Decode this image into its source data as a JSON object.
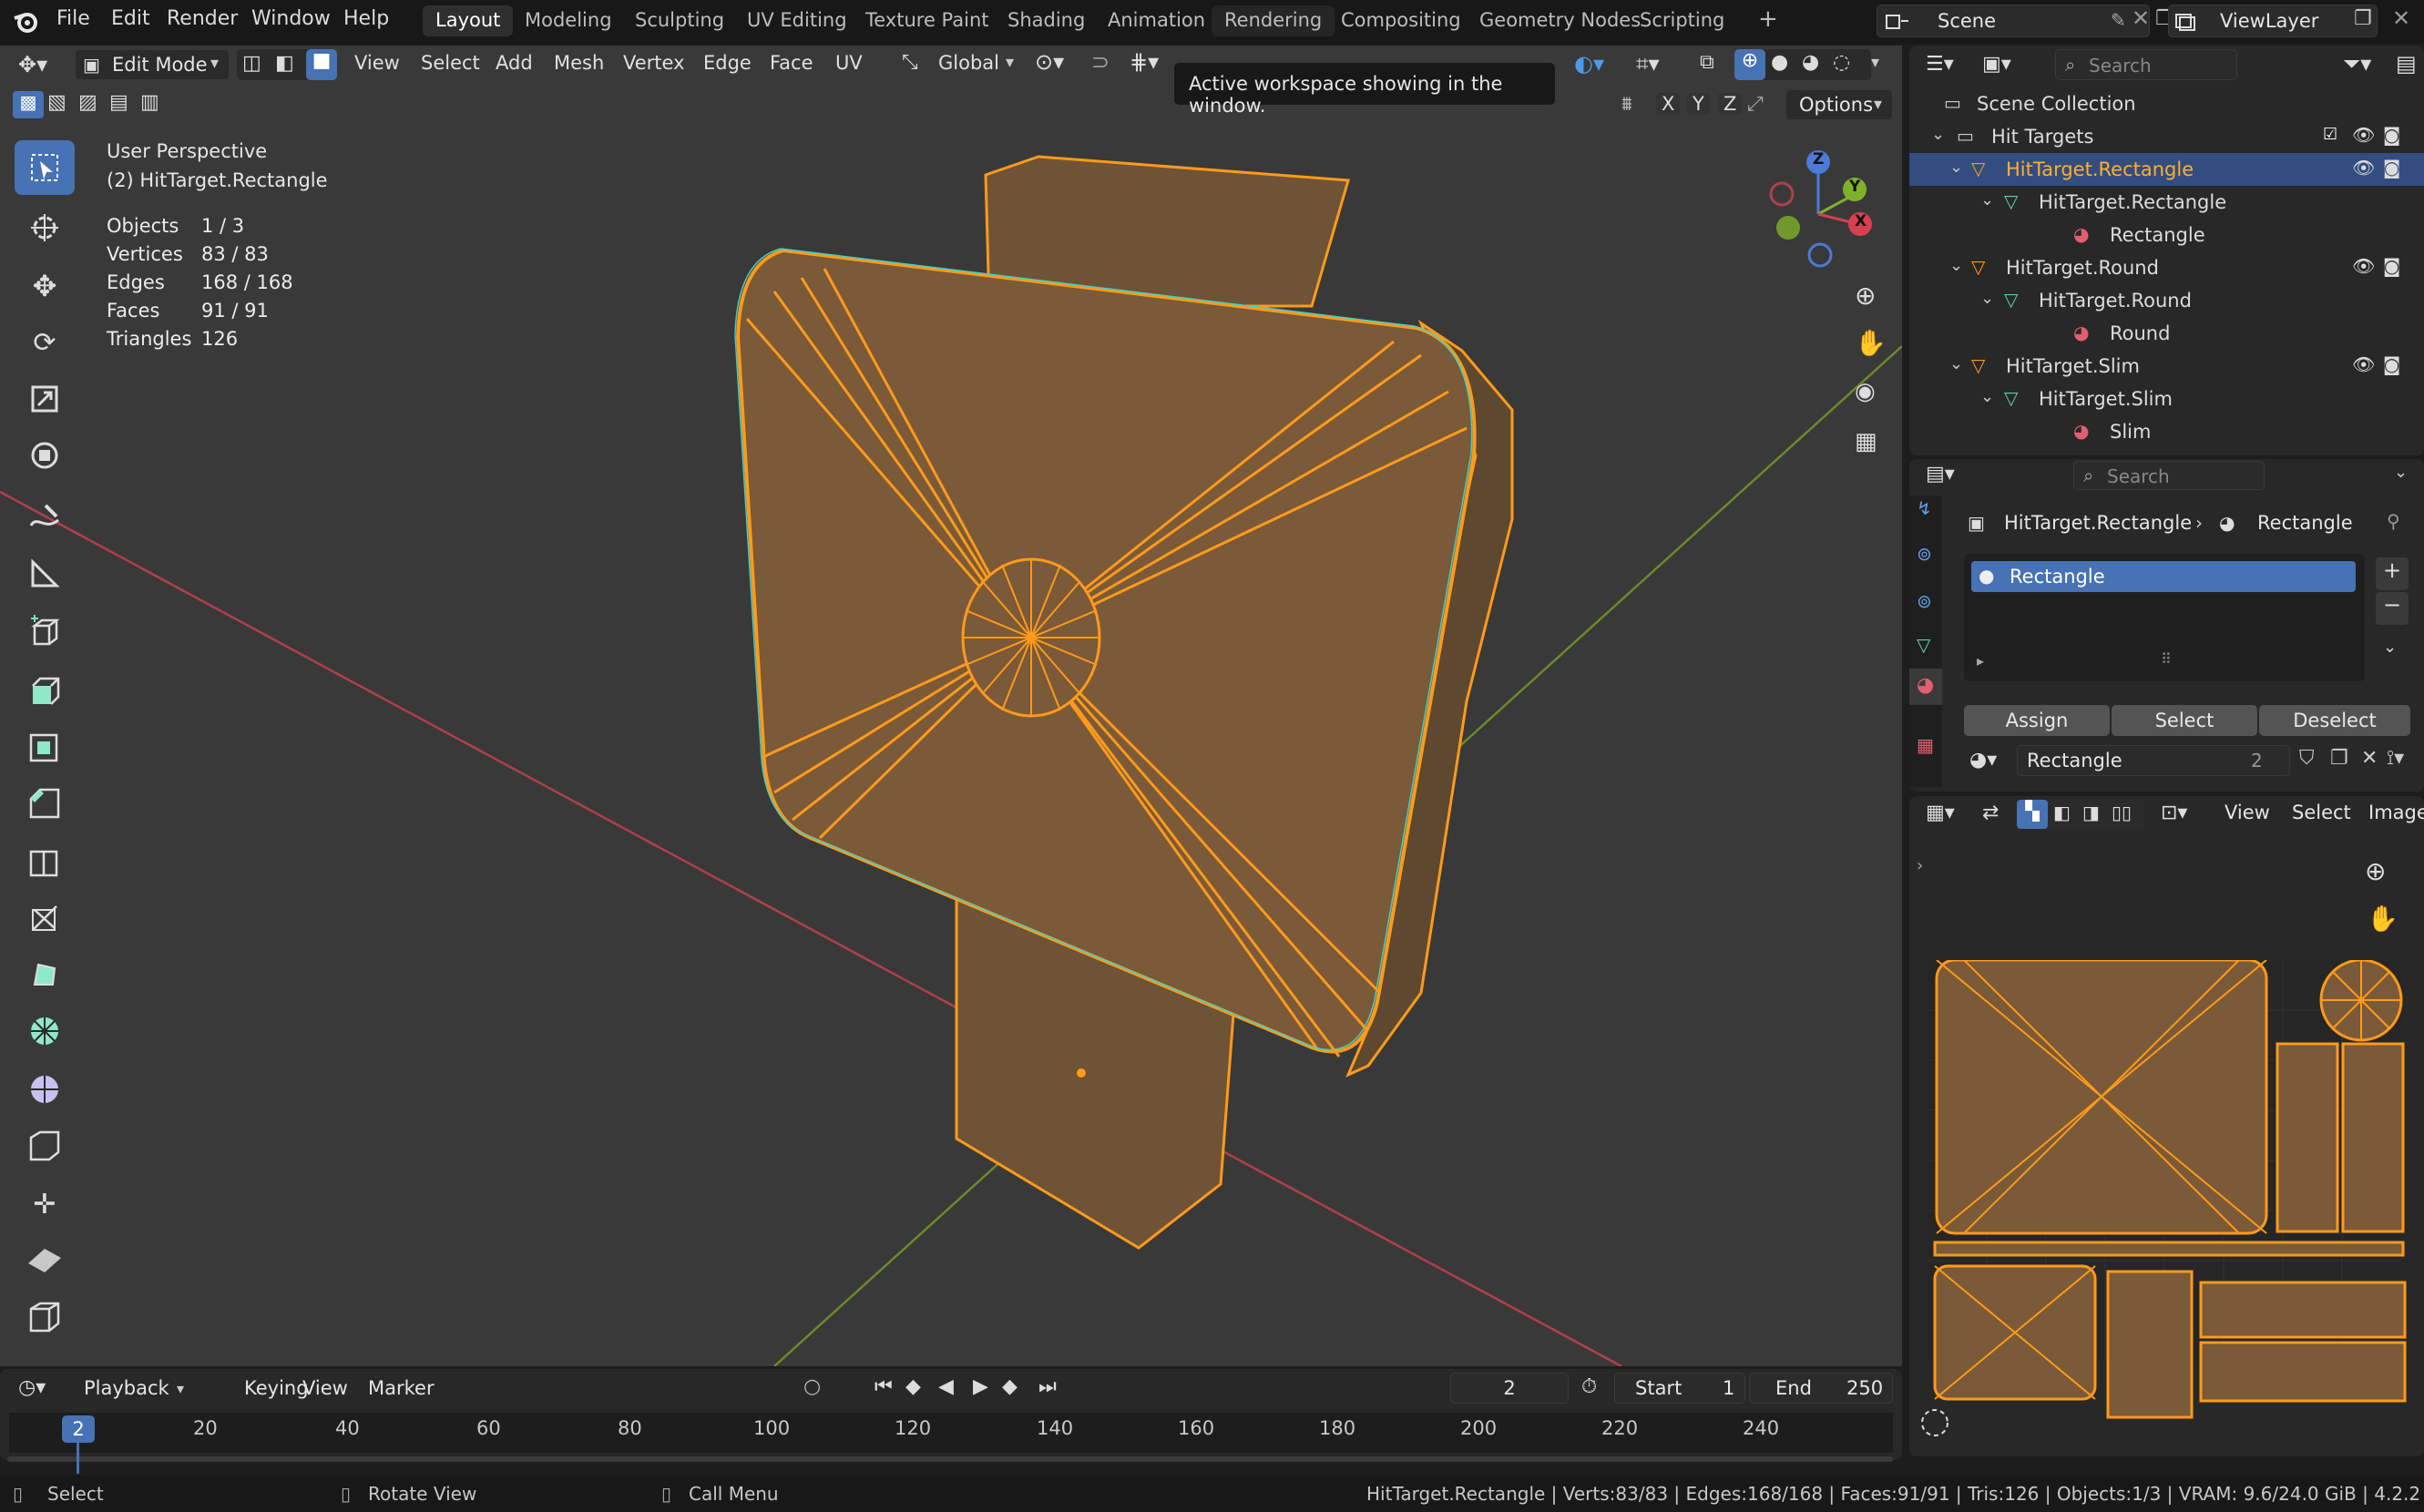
{
  "topbar": {
    "menus": [
      "File",
      "Edit",
      "Render",
      "Window",
      "Help"
    ],
    "workspaces": [
      "Layout",
      "Modeling",
      "Sculpting",
      "UV Editing",
      "Texture Paint",
      "Shading",
      "Animation",
      "Rendering",
      "Compositing",
      "Geometry Nodes",
      "Scripting"
    ],
    "add_workspace": "+",
    "scene": "Scene",
    "view_layer": "ViewLayer"
  },
  "viewport_header": {
    "mode": "Edit Mode",
    "menus": [
      "View",
      "Select",
      "Add",
      "Mesh",
      "Vertex",
      "Edge",
      "Face",
      "UV"
    ],
    "orientation": "Global",
    "axes": [
      "X",
      "Y",
      "Z"
    ],
    "options": "Options"
  },
  "tooltip": "Active workspace showing in the window.",
  "viewport_info": {
    "perspective": "User Perspective",
    "object": "(2) HitTarget.Rectangle",
    "stats": [
      {
        "label": "Objects",
        "value": "1 / 3"
      },
      {
        "label": "Vertices",
        "value": "83 / 83"
      },
      {
        "label": "Edges",
        "value": "168 / 168"
      },
      {
        "label": "Faces",
        "value": "91 / 91"
      },
      {
        "label": "Triangles",
        "value": "126"
      }
    ]
  },
  "gizmo": {
    "z": "Z",
    "y": "Y",
    "x": "X"
  },
  "outliner": {
    "search_placeholder": "Search",
    "rows": [
      {
        "text": "Scene Collection"
      },
      {
        "text": "Hit Targets"
      },
      {
        "text": "HitTarget.Rectangle"
      },
      {
        "text": "HitTarget.Rectangle"
      },
      {
        "text": "Rectangle"
      },
      {
        "text": "HitTarget.Round"
      },
      {
        "text": "HitTarget.Round"
      },
      {
        "text": "Round"
      },
      {
        "text": "HitTarget.Slim"
      },
      {
        "text": "HitTarget.Slim"
      },
      {
        "text": "Slim"
      }
    ]
  },
  "properties": {
    "search_placeholder": "Search",
    "breadcrumb_object": "HitTarget.Rectangle",
    "breadcrumb_material": "Rectangle",
    "slot": "Rectangle",
    "assign": "Assign",
    "select": "Select",
    "deselect": "Deselect",
    "material_name": "Rectangle",
    "users": "2"
  },
  "uv_header": {
    "menus": [
      "View",
      "Select",
      "Image"
    ]
  },
  "timeline": {
    "playback": "Playback",
    "keying": "Keying",
    "view": "View",
    "marker": "Marker",
    "current_frame": "2",
    "start_label": "Start",
    "start": "1",
    "end_label": "End",
    "end": "250",
    "ticks": [
      "20",
      "40",
      "60",
      "80",
      "100",
      "120",
      "140",
      "160",
      "180",
      "200",
      "220",
      "240"
    ],
    "playhead": "2"
  },
  "statusbar": {
    "select": "Select",
    "rotate": "Rotate View",
    "call_menu": "Call Menu",
    "info": "HitTarget.Rectangle | Verts:83/83 | Edges:168/168 | Faces:91/91 | Tris:126 | Objects:1/3 | VRAM: 9.6/24.0 GiB | 4.2.2"
  }
}
